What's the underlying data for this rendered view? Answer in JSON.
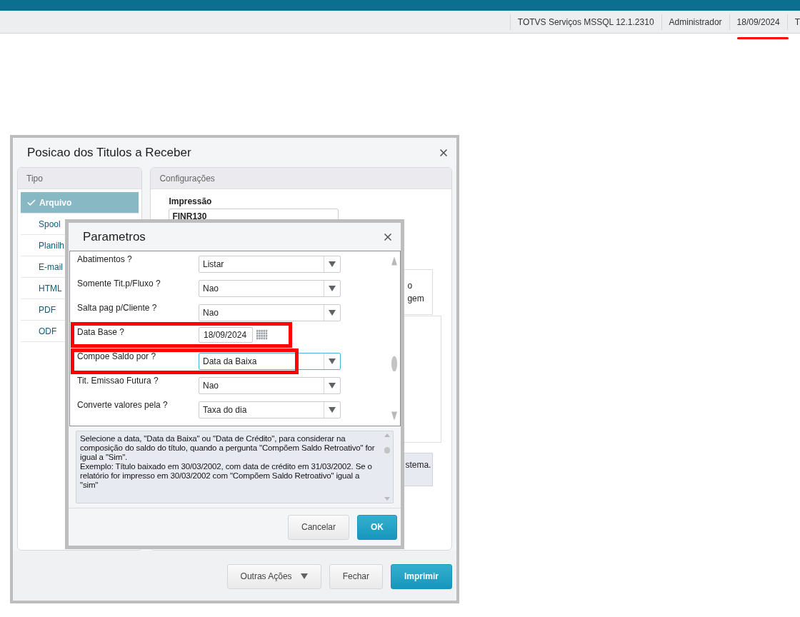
{
  "topbar": {
    "items": [
      "TOTVS Serviços MSSQL 12.1.2310",
      "Administrador",
      "18/09/2024",
      "T"
    ]
  },
  "dialog": {
    "title": "Posicao dos Titulos a Receber",
    "tipo": {
      "title": "Tipo",
      "items": [
        {
          "label": "Arquivo",
          "selected": true
        },
        {
          "label": "Spool",
          "selected": false
        },
        {
          "label": "Planilh",
          "selected": false
        },
        {
          "label": "E-mail",
          "selected": false
        },
        {
          "label": "HTML",
          "selected": false
        },
        {
          "label": "PDF",
          "selected": false
        },
        {
          "label": "ODF",
          "selected": false
        }
      ]
    },
    "config": {
      "title": "Configurações",
      "impressao_label": "Impressão",
      "impressao_value": "FINR130",
      "option_fragments": [
        "o",
        "gem"
      ],
      "note_fragment": "stema."
    },
    "buttons": [
      {
        "label": "Outras Ações",
        "kind": "menu"
      },
      {
        "label": "Fechar",
        "kind": "default"
      },
      {
        "label": "Imprimir",
        "kind": "primary"
      }
    ]
  },
  "parametros": {
    "title": "Parametros",
    "rows": [
      {
        "label": "Abatimentos ?",
        "kind": "select",
        "value": "Listar",
        "focused": false
      },
      {
        "label": "Somente Tit.p/Fluxo ?",
        "kind": "select",
        "value": "Nao",
        "focused": false
      },
      {
        "label": "Salta pag p/Cliente ?",
        "kind": "select",
        "value": "Nao",
        "focused": false
      },
      {
        "label": "Data Base ?",
        "kind": "date",
        "value": "18/09/2024",
        "focused": false
      },
      {
        "label": "Compoe Saldo por ?",
        "kind": "select",
        "value": "Data da Baixa",
        "focused": true
      },
      {
        "label": "Tit. Emissao Futura ?",
        "kind": "select",
        "value": "Nao",
        "focused": false
      },
      {
        "label": "Converte valores pela ?",
        "kind": "select",
        "value": "Taxa do dia",
        "focused": false
      }
    ],
    "help": "Selecione a data, \"Data da Baixa\" ou \"Data de Crédito\", para considerar na composição do saldo do título, quando a pergunta \"Compõem Saldo Retroativo\" for igual a \"Sim\".\nExemplo: Título baixado em 30/03/2002, com data de crédito em 31/03/2002. Se o relatório for impresso em  30/03/2002 com \"Compõem Saldo Retroativo\" igual a \"sim\"",
    "buttons": [
      {
        "label": "Cancelar",
        "kind": "default"
      },
      {
        "label": "OK",
        "kind": "primary"
      }
    ]
  }
}
